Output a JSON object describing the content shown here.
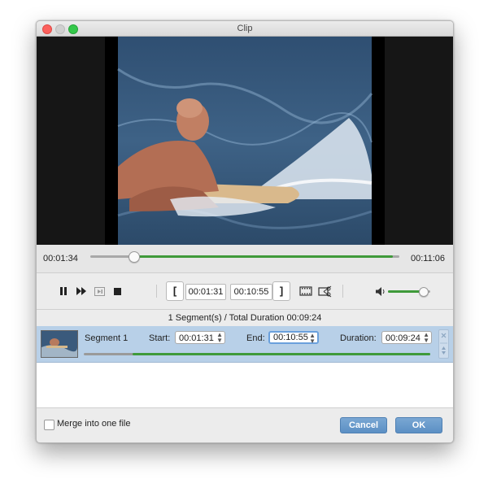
{
  "window": {
    "title": "Clip"
  },
  "timeline": {
    "current_time": "00:01:34",
    "total_time": "00:11:06",
    "start_fraction": 0.14,
    "end_fraction": 0.98
  },
  "controls": {
    "start_time": "00:01:31",
    "end_time": "00:10:55",
    "bracket_open": "[",
    "bracket_close": "]",
    "volume_fraction": 0.82
  },
  "summary": "1 Segment(s) / Total Duration 00:09:24",
  "segments": [
    {
      "name": "Segment 1",
      "start_label": "Start:",
      "start": "00:01:31",
      "end_label": "End:",
      "end": "00:10:55",
      "duration_label": "Duration:",
      "duration": "00:09:24",
      "range_fraction_start": 0.14,
      "range_fraction_end": 1.0
    }
  ],
  "footer": {
    "merge_label": "Merge into one file",
    "cancel_label": "Cancel",
    "ok_label": "OK"
  },
  "colors": {
    "accent_green": "#3f9a3a",
    "selection_blue": "#b8d0e8",
    "button_blue": "#5b8fc4"
  }
}
